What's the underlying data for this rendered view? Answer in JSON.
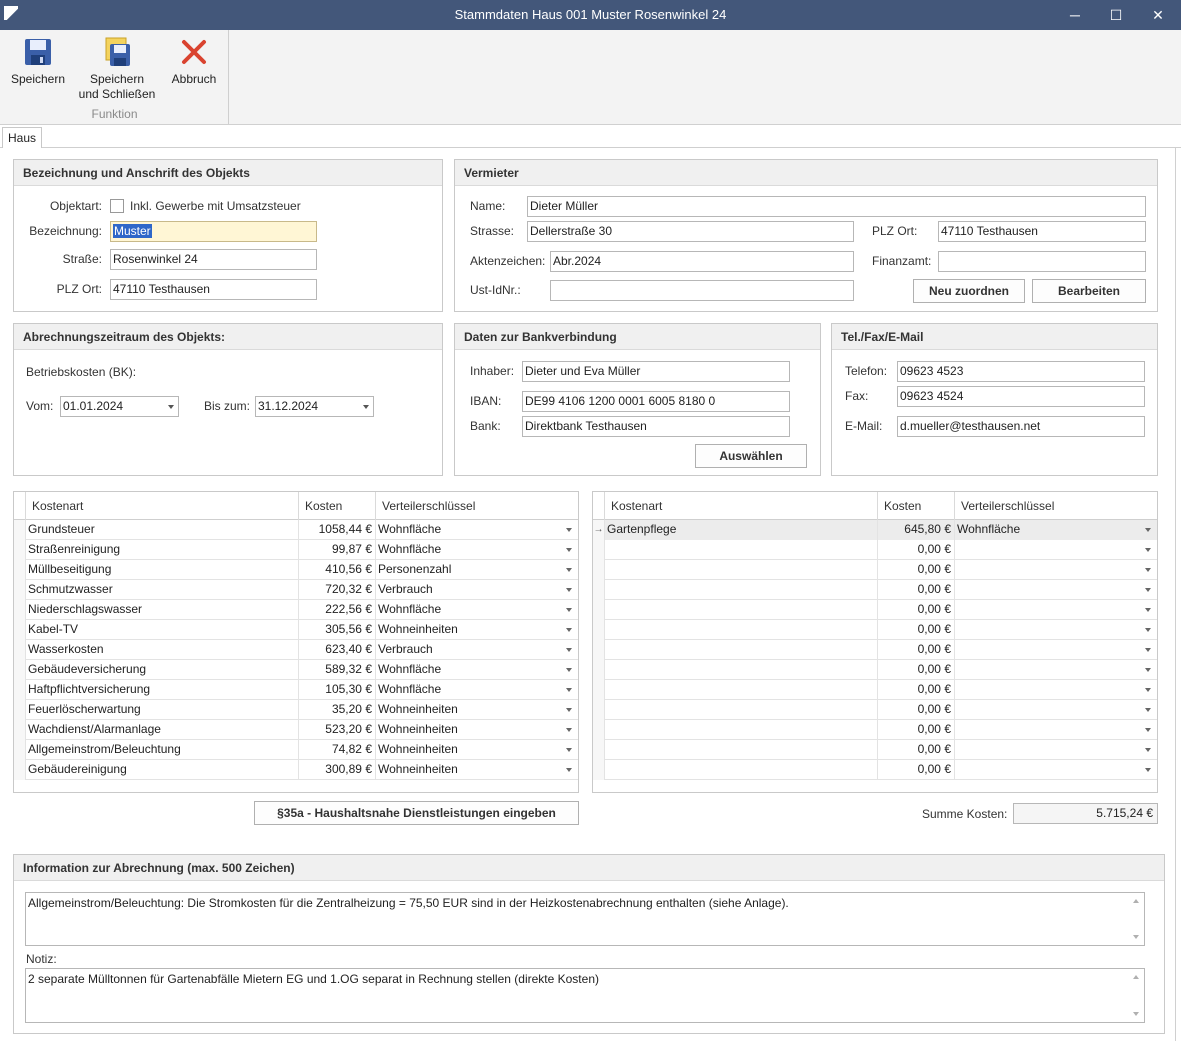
{
  "window": {
    "title": "Stammdaten Haus 001  Muster Rosenwinkel 24",
    "minimize": "─",
    "maximize": "☐",
    "close": "✕"
  },
  "ribbon": {
    "save": "Speichern",
    "save_close_line1": "Speichern",
    "save_close_line2": "und Schließen",
    "cancel": "Abbruch",
    "group_label": "Funktion"
  },
  "tabs": {
    "haus": "Haus"
  },
  "objekt": {
    "title": "Bezeichnung und Anschrift des Objekts",
    "objektart_label": "Objektart:",
    "gewerbe_label": "Inkl. Gewerbe mit Umsatzsteuer",
    "bezeichnung_label": "Bezeichnung:",
    "bezeichnung_value": "Muster",
    "strasse_label": "Straße:",
    "strasse_value": "Rosenwinkel 24",
    "plz_label": "PLZ Ort:",
    "plz_value": "47110 Testhausen"
  },
  "vermieter": {
    "title": "Vermieter",
    "name_label": "Name:",
    "name_value": "Dieter Müller",
    "strasse_label": "Strasse:",
    "strasse_value": "Dellerstraße 30",
    "plz_label": "PLZ Ort:",
    "plz_value": "47110 Testhausen",
    "akten_label": "Aktenzeichen:",
    "akten_value": "Abr.2024",
    "finanzamt_label": "Finanzamt:",
    "finanzamt_value": "",
    "ust_label": "Ust-IdNr.:",
    "ust_value": "",
    "neu_button": "Neu zuordnen",
    "bearbeiten_button": "Bearbeiten"
  },
  "zeitraum": {
    "title": "Abrechnungszeitraum des Objekts:",
    "bk_label": "Betriebskosten (BK):",
    "vom_label": "Vom:",
    "vom_value": "01.01.2024",
    "bis_label": "Bis zum:",
    "bis_value": "31.12.2024"
  },
  "bank": {
    "title": "Daten zur Bankverbindung",
    "inhaber_label": "Inhaber:",
    "inhaber_value": "Dieter und Eva Müller",
    "iban_label": "IBAN:",
    "iban_value": "DE99 4106 1200 0001 6005 8180 0",
    "bank_label": "Bank:",
    "bank_value": "Direktbank Testhausen",
    "select_button": "Auswählen"
  },
  "kontakt": {
    "title": "Tel./Fax/E-Mail",
    "telefon_label": "Telefon:",
    "telefon_value": "09623 4523",
    "fax_label": "Fax:",
    "fax_value": "09623 4524",
    "email_label": "E-Mail:",
    "email_value": "d.mueller@testhausen.net"
  },
  "grid_left": {
    "headers": [
      "Kostenart",
      "Kosten",
      "Verteilerschlüssel"
    ],
    "rows": [
      {
        "art": "Grundsteuer",
        "kosten": "1058,44 €",
        "key": "Wohnfläche"
      },
      {
        "art": "Straßenreinigung",
        "kosten": "99,87 €",
        "key": "Wohnfläche"
      },
      {
        "art": "Müllbeseitigung",
        "kosten": "410,56 €",
        "key": "Personenzahl"
      },
      {
        "art": "Schmutzwasser",
        "kosten": "720,32 €",
        "key": "Verbrauch"
      },
      {
        "art": "Niederschlagswasser",
        "kosten": "222,56 €",
        "key": "Wohnfläche"
      },
      {
        "art": "Kabel-TV",
        "kosten": "305,56 €",
        "key": "Wohneinheiten"
      },
      {
        "art": "Wasserkosten",
        "kosten": "623,40 €",
        "key": "Verbrauch"
      },
      {
        "art": "Gebäudeversicherung",
        "kosten": "589,32 €",
        "key": "Wohnfläche"
      },
      {
        "art": "Haftpflichtversicherung",
        "kosten": "105,30 €",
        "key": "Wohnfläche"
      },
      {
        "art": "Feuerlöscherwartung",
        "kosten": "35,20 €",
        "key": "Wohneinheiten"
      },
      {
        "art": "Wachdienst/Alarmanlage",
        "kosten": "523,20 €",
        "key": "Wohneinheiten"
      },
      {
        "art": "Allgemeinstrom/Beleuchtung",
        "kosten": "74,82 €",
        "key": "Wohneinheiten"
      },
      {
        "art": "Gebäudereinigung",
        "kosten": "300,89 €",
        "key": "Wohneinheiten"
      }
    ]
  },
  "grid_right": {
    "headers": [
      "Kostenart",
      "Kosten",
      "Verteilerschlüssel"
    ],
    "row_indicator": "→",
    "rows": [
      {
        "art": "Gartenpflege",
        "kosten": "645,80 €",
        "key": "Wohnfläche"
      },
      {
        "art": "",
        "kosten": "0,00 €",
        "key": ""
      },
      {
        "art": "",
        "kosten": "0,00 €",
        "key": ""
      },
      {
        "art": "",
        "kosten": "0,00 €",
        "key": ""
      },
      {
        "art": "",
        "kosten": "0,00 €",
        "key": ""
      },
      {
        "art": "",
        "kosten": "0,00 €",
        "key": ""
      },
      {
        "art": "",
        "kosten": "0,00 €",
        "key": ""
      },
      {
        "art": "",
        "kosten": "0,00 €",
        "key": ""
      },
      {
        "art": "",
        "kosten": "0,00 €",
        "key": ""
      },
      {
        "art": "",
        "kosten": "0,00 €",
        "key": ""
      },
      {
        "art": "",
        "kosten": "0,00 €",
        "key": ""
      },
      {
        "art": "",
        "kosten": "0,00 €",
        "key": ""
      },
      {
        "art": "",
        "kosten": "0,00 €",
        "key": ""
      }
    ]
  },
  "haushalt_button": "§35a - Haushaltsnahe Dienstleistungen eingeben",
  "summe": {
    "label": "Summe Kosten:",
    "value": "5.715,24 €"
  },
  "info": {
    "title": "Information zur Abrechnung (max. 500 Zeichen)",
    "text": "Allgemeinstrom/Beleuchtung: Die Stromkosten für die Zentralheizung = 75,50 EUR sind in der Heizkostenabrechnung enthalten (siehe Anlage).",
    "notiz_label": "Notiz:",
    "notiz_text": "2 separate Mülltonnen für Gartenabfälle Mietern EG und 1.OG separat in Rechnung stellen (direkte Kosten)"
  }
}
